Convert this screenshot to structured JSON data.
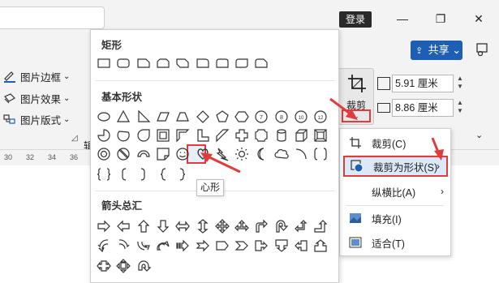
{
  "titlebar": {
    "login_label": "登录",
    "minimize_glyph": "—",
    "restore_glyph": "❐",
    "close_glyph": "✕"
  },
  "share": {
    "label": "共享",
    "icon": "share-icon",
    "chevron": "⌄"
  },
  "ribbon": {
    "picture_border": "图片边框",
    "picture_effects": "图片效果",
    "picture_layout": "图片版式",
    "dropdown_glyph": "⌄",
    "partial_label": "辑",
    "crop_label": "裁剪",
    "height_value": "5.91 厘米",
    "width_value": "8.86 厘米"
  },
  "ruler": {
    "ticks": [
      "30",
      "32",
      "34",
      "36"
    ]
  },
  "gallery": {
    "section_rectangles": "矩形",
    "section_basic_shapes": "基本形状",
    "section_block_arrows": "箭头总汇",
    "tooltip": "心形"
  },
  "crop_menu": {
    "items": [
      {
        "label": "裁剪(C)",
        "icon": "crop-icon",
        "submenu": false
      },
      {
        "label": "裁剪为形状(S)",
        "icon": "crop-to-shape-icon",
        "submenu": true
      },
      {
        "label": "纵横比(A)",
        "icon": "",
        "submenu": true
      },
      {
        "label": "填充(I)",
        "icon": "fill-icon",
        "submenu": false
      },
      {
        "label": "适合(T)",
        "icon": "fit-icon",
        "submenu": false
      }
    ]
  },
  "colors": {
    "accent": "#1e5fb4",
    "highlight_red": "#e23b3b",
    "menu_highlight": "#dce8f7"
  }
}
